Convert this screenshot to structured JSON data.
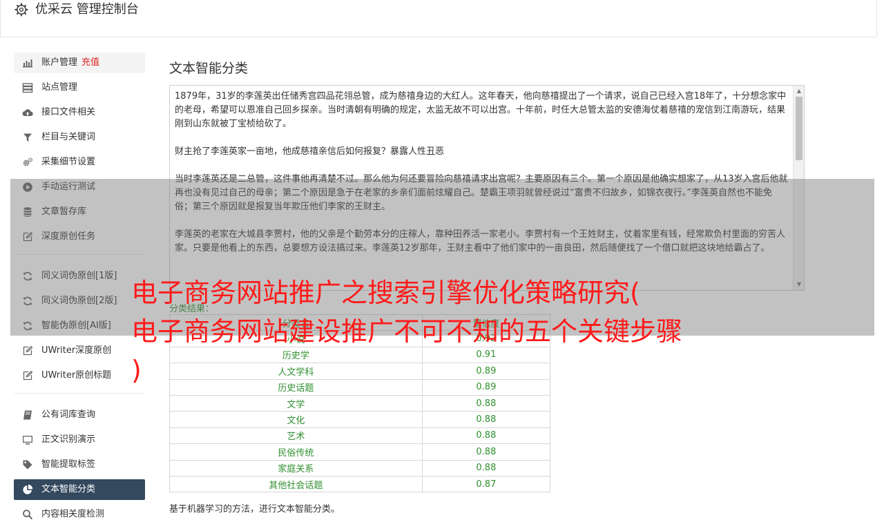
{
  "header": {
    "title": "优采云 管理控制台",
    "icon": "gear-icon"
  },
  "sidebar": {
    "groups": [
      {
        "items": [
          {
            "label": "账户管理",
            "tag": "充值",
            "icon": "bar-chart-icon"
          },
          {
            "label": "站点管理",
            "icon": "server-icon"
          },
          {
            "label": "接口文件相关",
            "icon": "cloud-upload-icon"
          },
          {
            "label": "栏目与关键词",
            "icon": "filter-icon"
          },
          {
            "label": "采集细节设置",
            "icon": "gears-icon"
          },
          {
            "label": "手动运行测试",
            "icon": "play-circle-icon"
          },
          {
            "label": "文章暂存库",
            "icon": "database-icon"
          },
          {
            "label": "深度原创任务",
            "icon": "edit-icon"
          }
        ]
      },
      {
        "items": [
          {
            "label": "同义词伪原创[1版]",
            "icon": "refresh-icon"
          },
          {
            "label": "同义词伪原创[2版]",
            "icon": "refresh-icon"
          },
          {
            "label": "智能伪原创[AI版]",
            "icon": "refresh-icon"
          },
          {
            "label": "UWriter深度原创",
            "icon": "edit-icon"
          },
          {
            "label": "UWriter原创标题",
            "icon": "edit-icon"
          }
        ]
      },
      {
        "items": [
          {
            "label": "公有词库查询",
            "icon": "book-icon"
          },
          {
            "label": "正文识别演示",
            "icon": "monitor-icon"
          },
          {
            "label": "智能提取标签",
            "icon": "tag-icon"
          },
          {
            "label": "文本智能分类",
            "icon": "pie-chart-icon",
            "active": true
          },
          {
            "label": "内容相关度检测",
            "icon": "search-icon"
          }
        ]
      }
    ]
  },
  "main": {
    "title": "文本智能分类",
    "paragraphs": [
      "1879年，31岁的李莲英出任储秀宫四品花翎总管，成为慈禧身边的大红人。这年春天，他向慈禧提出了一个请求，说自己已经入宫18年了，十分想念家中的老母，希望可以恩准自己回乡探亲。当时清朝有明确的规定，太监无故不可以出宫。十年前，时任大总管太监的安德海仗着慈禧的宠信到江南游玩，结果刚到山东就被丁宝桢给砍了。",
      "财主抢了李莲英家一亩地，他成慈禧亲信后如何报复？暴露人性丑恶",
      "当时李莲英还是二总管，这件事他再清楚不过。那么他为何还要冒险向慈禧请求出宫呢？主要原因有三个。第一个原因是他确实想家了，从13岁入宫后他就再也没有见过自己的母亲；第二个原因是急于在老家的乡亲们面前炫耀自己。楚霸王项羽就曾经说过“富贵不归故乡，如锦衣夜行。”李莲英自然也不能免俗；第三个原因就是报复当年欺压他们李家的王财主。",
      "李莲英的老家在大城县李贾村，他的父亲是个勤劳本分的庄稼人，靠种田养活一家老小。李贾村有一个王姓财主，仗着家里有钱，经常欺负村里面的穷苦人家。只要是他看上的东西，总要想方设法搞过来。李莲英12岁那年，王财主看中了他们家中的一亩良田，然后随便找了一个借口就把这块地给霸占了。"
    ],
    "result_label": "分类结果：",
    "table": {
      "headers": [
        "分类名",
        "置信度"
      ],
      "rows": [
        [
          "小说",
          "0.92"
        ],
        [
          "历史学",
          "0.91"
        ],
        [
          "人文学科",
          "0.89"
        ],
        [
          "历史话题",
          "0.89"
        ],
        [
          "文学",
          "0.88"
        ],
        [
          "文化",
          "0.88"
        ],
        [
          "艺术",
          "0.88"
        ],
        [
          "民俗传统",
          "0.88"
        ],
        [
          "家庭关系",
          "0.88"
        ],
        [
          "其他社会话题",
          "0.87"
        ]
      ]
    },
    "footnote": "基于机器学习的方法，进行文本智能分类。"
  },
  "overlay": {
    "lines": [
      "电子商务网站推广之搜索引擎优化策略研究(",
      "电子商务网站建设推广不可不知的五个关键步骤",
      ")"
    ]
  },
  "colors": {
    "active_bg": "#34495e",
    "result_green": "#2f8f2f",
    "tag_red": "#d9231c",
    "overlay_red": "#ff1a1a"
  }
}
